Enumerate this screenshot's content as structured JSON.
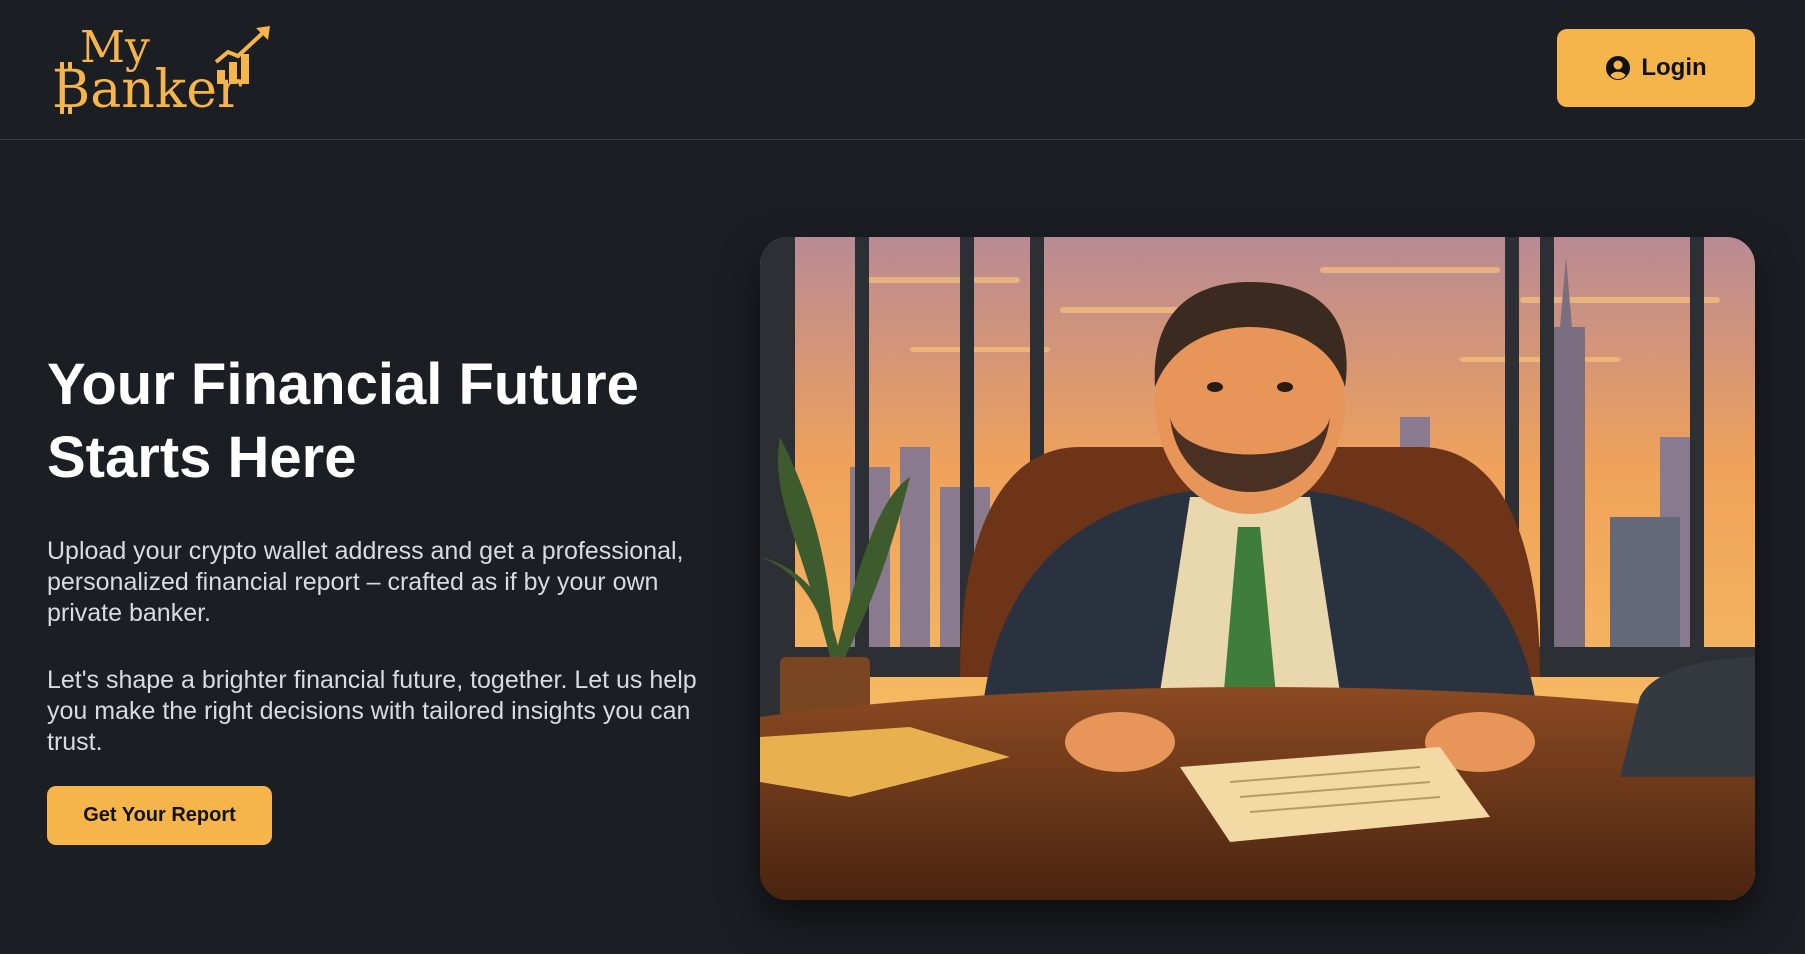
{
  "header": {
    "logo": {
      "line1": "My",
      "line2": "Banker",
      "brand_color": "#f5b54a"
    },
    "login": {
      "label": "Login",
      "icon": "user-circle-icon"
    }
  },
  "hero": {
    "title_line1": "Your Financial Future",
    "title_line2": "Starts Here",
    "paragraph1": "Upload your crypto wallet address and get a professional, personalized financial report – crafted as if by your own private banker.",
    "paragraph2": "Let's shape a brighter financial future, together. Let us help you make the right decisions with tailored insights you can trust.",
    "cta_label": "Get Your Report",
    "illustration": "banker-office-illustration"
  },
  "colors": {
    "background": "#1b1e23",
    "accent": "#f5b54a",
    "text": "#ffffff",
    "muted_text": "#d9dbe0"
  }
}
